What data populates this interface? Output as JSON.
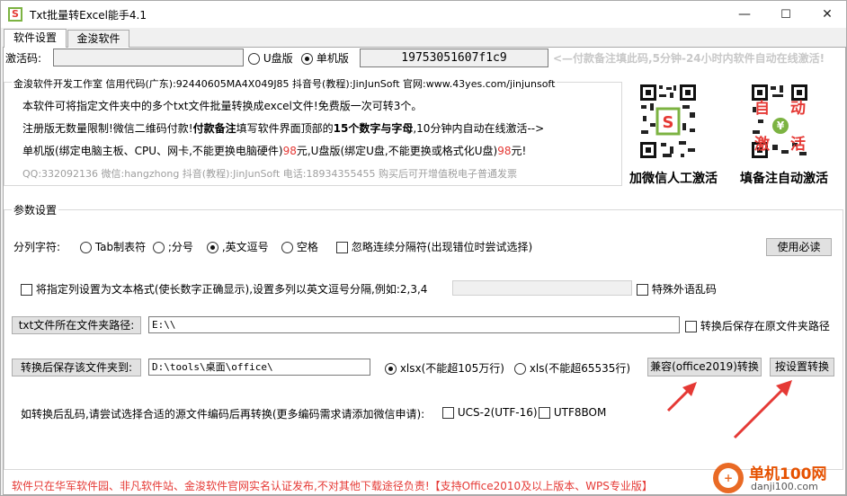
{
  "window": {
    "title": "Txt批量转Excel能手4.1",
    "icon_letter": "S",
    "icon": "app-icon"
  },
  "window_controls": {
    "minimize": "—",
    "maximize": "☐",
    "close": "✕"
  },
  "tabs": [
    {
      "label": "软件设置",
      "active": true
    },
    {
      "label": "金浚软件",
      "active": false
    }
  ],
  "activation": {
    "label": "激活码:",
    "input_value": "",
    "usb_label": "U盘版",
    "usb_selected": false,
    "single_label": "单机版",
    "single_selected": true,
    "machine_code": "19753051607f1c9",
    "hint": "<—付款备注填此码,5分钟-24小时内软件自动在线激活!"
  },
  "intro": {
    "title": "金浚软件开发工作室  信用代码(广东):92440605MA4X049J85  抖音号(教程):JinJunSoft  官网:www.43yes.com/jinjunsoft",
    "line1": "本软件可将指定文件夹中的多个txt文件批量转换成excel文件!免费版一次可转3个。",
    "line2_a": "注册版无数量限制!微信二维码付款!",
    "line2_b": "付款备注",
    "line2_c": "填写软件界面顶部的",
    "line2_d": "15个数字与字母",
    "line2_e": ",10分钟内自动在线激活-->",
    "line3_a": "单机版(绑定电脑主板、CPU、网卡,不能更换电脑硬件)",
    "line3_price1": "98",
    "line3_b": "元,U盘版(绑定U盘,不能更换或格式化U盘)",
    "line3_price2": "98",
    "line3_c": "元!",
    "line4": "QQ:332092136 微信:hangzhong 抖音(教程):JinJunSoft 电话:18934355455 购买后可开增值税电子普通发票"
  },
  "qr": [
    {
      "caption": "加微信人工激活",
      "icon": "wechat-qr-icon"
    },
    {
      "caption": "填备注自动激活",
      "icon": "pay-qr-icon",
      "overlay": [
        "自",
        "动",
        "激",
        "活"
      ]
    }
  ],
  "params": {
    "title": "参数设置",
    "delimiter_label": "分列字符:",
    "delimiters": [
      {
        "label": "Tab制表符",
        "selected": false
      },
      {
        "label": ";分号",
        "selected": false
      },
      {
        "label": ",英文逗号",
        "selected": true
      },
      {
        "label": "空格",
        "selected": false
      }
    ],
    "ignore_consecutive": "忽略连续分隔符(出现错位时尝试选择)",
    "must_read_button": "使用必读",
    "text_format_check": "将指定列设置为文本格式(使长数字正确显示),设置多列以英文逗号分隔,例如:2,3,4",
    "foreign_garble": "特殊外语乱码",
    "source_folder_button": "txt文件所在文件夹路径:",
    "source_folder_value": "E:\\\\",
    "save_in_source": "转换后保存在原文件夹路径",
    "dest_folder_button": "转换后保存该文件夹到:",
    "dest_folder_value": "D:\\tools\\桌面\\office\\",
    "xlsx_label": "xlsx(不能超105万行)",
    "xlsx_selected": true,
    "xls_label": "xls(不能超65535行)",
    "xls_selected": false,
    "compat_button": "兼容(office2019)转换",
    "convert_button": "按设置转换",
    "encoding_hint": "如转换后乱码,请尝试选择合适的源文件编码后再转换(更多编码需求请添加微信申请):",
    "enc_utf16": "UCS-2(UTF-16)",
    "enc_utf8bom": "UTF8BOM"
  },
  "footer": "软件只在华军软件园、非凡软件站、金浚软件官网实名认证发布,不对其他下载途径负责!【支持Office2010及以上版本、WPS专业版】",
  "watermark": {
    "site": "单机100网",
    "domain": "danji100.com"
  },
  "colors": {
    "accent_red": "#e53935",
    "qr_green": "#7cb342",
    "arrow_red": "#e53935",
    "hint_gray": "#c8c8c8"
  }
}
